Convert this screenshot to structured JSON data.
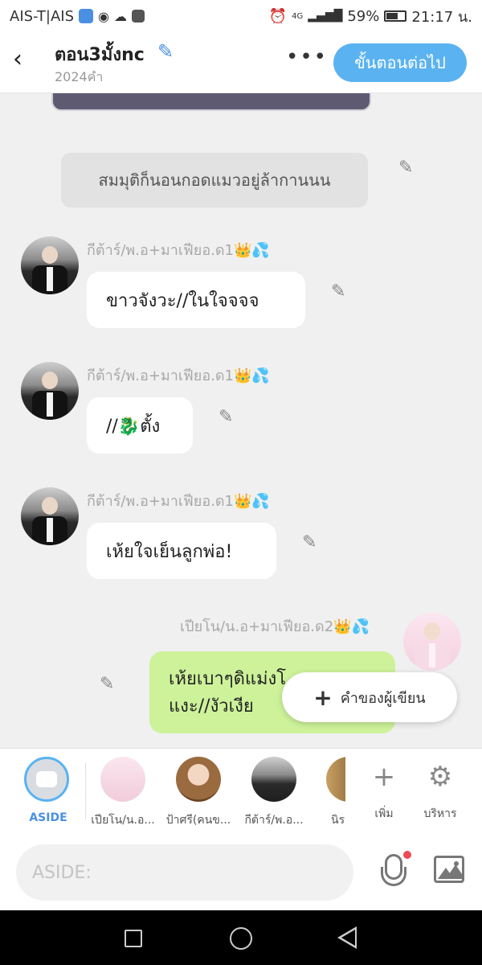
{
  "status_bar": {
    "carrier": "AIS-T|AIS",
    "network": "4G",
    "battery": "59%",
    "time": "21:17 น."
  },
  "header": {
    "title": "ตอน3มั้งnc",
    "word_count": "2024คำ",
    "more_icon": "more-horizontal-icon",
    "next_button": "ขั้นตอนต่อไป"
  },
  "messages": {
    "narration": "สมมุติก็นอนกอดแมวอยู่ล้ากานนน",
    "m1": {
      "speaker": "กีต้าร์/พ.อ+มาเฟียอ.ด1👑💦",
      "text": "ขาวจังวะ//ในใจจจจ"
    },
    "m2": {
      "speaker": "กีต้าร์/พ.อ+มาเฟียอ.ด1👑💦",
      "text": "//🐉ตั้ง"
    },
    "m3": {
      "speaker": "กีต้าร์/พ.อ+มาเฟียอ.ด1👑💦",
      "text": "เห้ยใจเย็นลูกพ่อ!"
    },
    "m4": {
      "speaker": "เปียโน/น.อ+มาเฟียอ.ด2👑💦",
      "line1": "เห้ยเบาๆดิแม่งโ",
      "line2": "แงะ//งัวเงีย"
    }
  },
  "floating": {
    "label": "คำของผู้เขียน"
  },
  "characters": {
    "aside": "ASIDE",
    "c1": "เปียโน/น.อ...",
    "c2": "ป้าศรี(คนข...",
    "c3": "กีต้าร์/พ.อ...",
    "c4": "นิร",
    "add": "เพิ่ม",
    "manage": "บริหาร"
  },
  "input": {
    "placeholder": "ASIDE:"
  },
  "colors": {
    "accent": "#5ab3f0",
    "my_bubble": "#cdf29a",
    "mic_dot": "#f04a55"
  }
}
